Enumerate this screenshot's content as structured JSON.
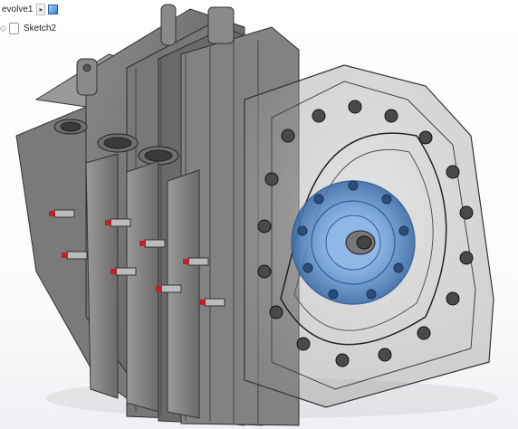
{
  "feature_tree": {
    "revolve_label": "evolve1",
    "revolve_icon": "revolve-feature-icon",
    "sketch_label": "Sketch2",
    "sketch_icon": "sketch-icon"
  },
  "viewport": {
    "background": "#ffffff",
    "model_description_color": "#7b7b7b",
    "selection_color": "#3f7fd0",
    "spark_plug_tip_color": "#c0202a"
  }
}
